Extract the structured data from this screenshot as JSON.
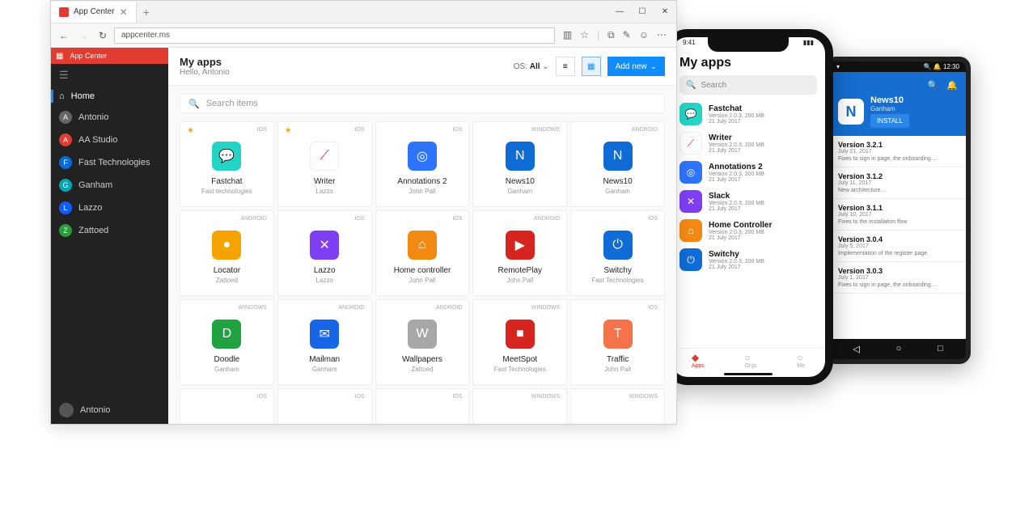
{
  "browser": {
    "tab_title": "App Center",
    "url": "appcenter.ms",
    "window_controls": {
      "min": "—",
      "max": "☐",
      "close": "✕"
    }
  },
  "sidebar": {
    "brand": "App Center",
    "home": "Home",
    "items": [
      {
        "label": "Antonio",
        "color": "#666"
      },
      {
        "label": "AA Studio",
        "color": "#e03c31"
      },
      {
        "label": "Fast Technologies",
        "color": "#0b6bd6"
      },
      {
        "label": "Ganham",
        "color": "#00a8b5"
      },
      {
        "label": "Lazzo",
        "color": "#0f5cff"
      },
      {
        "label": "Zattoed",
        "color": "#2a9d3a"
      }
    ],
    "footer_user": "Antonio"
  },
  "main": {
    "title": "My apps",
    "hello": "Hello, Antonio",
    "os_label": "OS: ",
    "os_value": "All",
    "add_label": "Add new",
    "search_placeholder": "Search items",
    "apps": [
      {
        "name": "Fastchat",
        "sub": "Fast technologies",
        "os": "iOS",
        "star": true,
        "color": "#24d4c4",
        "glyph": "💬"
      },
      {
        "name": "Writer",
        "sub": "Lazzo",
        "os": "iOS",
        "star": true,
        "color": "#fff",
        "glyph": "⟋",
        "border": "#eee",
        "fg": "#e06"
      },
      {
        "name": "Annotations 2",
        "sub": "John Pall",
        "os": "iOS",
        "color": "#2e74ff",
        "glyph": "◎"
      },
      {
        "name": "News10",
        "sub": "Ganham",
        "os": "WINDOWS",
        "color": "#0f6bd6",
        "glyph": "N"
      },
      {
        "name": "News10",
        "sub": "Ganham",
        "os": "ANDROID",
        "color": "#0f6bd6",
        "glyph": "N"
      },
      {
        "name": "Locator",
        "sub": "Zattoed",
        "os": "ANDROID",
        "color": "#f6a300",
        "glyph": "●"
      },
      {
        "name": "Lazzo",
        "sub": "Lazzo",
        "os": "iOS",
        "color": "#7e3ff2",
        "glyph": "✕"
      },
      {
        "name": "Home controller",
        "sub": "John Pall",
        "os": "iOS",
        "color": "#f28a12",
        "glyph": "⌂"
      },
      {
        "name": "RemotePlay",
        "sub": "John Pall",
        "os": "ANDROID",
        "color": "#d6241f",
        "glyph": "▶"
      },
      {
        "name": "Switchy",
        "sub": "Fast Technologies",
        "os": "iOS",
        "color": "#0f6bd6",
        "glyph": "⏻"
      },
      {
        "name": "Doodle",
        "sub": "Ganham",
        "os": "WINDOWS",
        "color": "#1fa340",
        "glyph": "D"
      },
      {
        "name": "Mailman",
        "sub": "Ganham",
        "os": "ANDROID",
        "color": "#1766e8",
        "glyph": "✉"
      },
      {
        "name": "Wallpapers",
        "sub": "Zattoed",
        "os": "ANDROID",
        "color": "#a7a7a7",
        "glyph": "W"
      },
      {
        "name": "MeetSpot",
        "sub": "Fast Technologies",
        "os": "WINDOWS",
        "color": "#d6241f",
        "glyph": "■"
      },
      {
        "name": "Traffic",
        "sub": "John Pall",
        "os": "iOS",
        "color": "#f5734a",
        "glyph": "T"
      },
      {
        "name": "",
        "sub": "",
        "os": "iOS"
      },
      {
        "name": "",
        "sub": "",
        "os": "iOS"
      },
      {
        "name": "",
        "sub": "",
        "os": "iOS"
      },
      {
        "name": "",
        "sub": "",
        "os": "WINDOWS"
      },
      {
        "name": "",
        "sub": "",
        "os": "WINDOWS"
      }
    ]
  },
  "ios": {
    "time": "9:41",
    "title": "My apps",
    "search": "Search",
    "apps": [
      {
        "name": "Fastchat",
        "meta": "Version 2.0.3, 200 MB",
        "date": "21 July 2017",
        "color": "#24d4c4",
        "glyph": "💬"
      },
      {
        "name": "Writer",
        "meta": "Version 2.0.3, 200 MB",
        "date": "21 July 2017",
        "color": "#fff",
        "glyph": "⟋",
        "fg": "#e06",
        "border": "#eee"
      },
      {
        "name": "Annotations 2",
        "meta": "Version 2.0.3, 200 MB",
        "date": "21 July 2017",
        "color": "#2e74ff",
        "glyph": "◎"
      },
      {
        "name": "Slack",
        "meta": "Version 2.0.3, 200 MB",
        "date": "21 July 2017",
        "color": "#7e3ff2",
        "glyph": "✕"
      },
      {
        "name": "Home Controller",
        "meta": "Version 2.0.3, 200 MB",
        "date": "21 July 2017",
        "color": "#f28a12",
        "glyph": "⌂"
      },
      {
        "name": "Switchy",
        "meta": "Version 2.0.3, 200 MB",
        "date": "21 July 2017",
        "color": "#0f6bd6",
        "glyph": "⏻"
      }
    ],
    "tabs": [
      {
        "label": "Apps",
        "active": true
      },
      {
        "label": "Orgs"
      },
      {
        "label": "Me"
      }
    ]
  },
  "android": {
    "time": "12:30",
    "header_app": "News10",
    "header_org": "Ganham",
    "install": "INSTALL",
    "versions": [
      {
        "v": "Version 3.2.1",
        "d": "July 21, 2017",
        "desc": "Fixes to sign in page, the onboarding…"
      },
      {
        "v": "Version 3.1.2",
        "d": "July 11, 2017",
        "desc": "New architecture…"
      },
      {
        "v": "Version 3.1.1",
        "d": "July 10, 2017",
        "desc": "Fixes to the installation flow"
      },
      {
        "v": "Version 3.0.4",
        "d": "July 5, 2017",
        "desc": "Implementation of the register page"
      },
      {
        "v": "Version 3.0.3",
        "d": "July 1, 2017",
        "desc": "Fixes to sign in page, the onboarding…"
      }
    ]
  }
}
